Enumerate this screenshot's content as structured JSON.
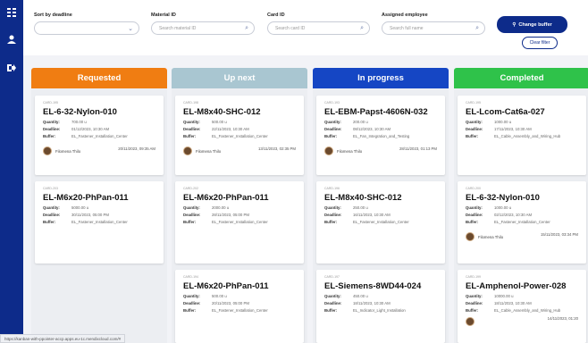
{
  "sidebar": {
    "icons": [
      "grid-icon",
      "user-icon",
      "logout-icon"
    ]
  },
  "filters": {
    "sort_label": "Sort by deadline",
    "sort_value": "",
    "material_label": "Material ID",
    "material_placeholder": "Search material ID",
    "card_label": "Card ID",
    "card_placeholder": "Search card ID",
    "employee_label": "Assigned employee",
    "employee_placeholder": "Search full name",
    "change_buffer_label": "Change buffer",
    "clear_filter_label": "Clear filter"
  },
  "colors": {
    "requested": "#f07d12",
    "up_next": "#a9c6d1",
    "in_progress": "#1546c4",
    "completed": "#2fc24a"
  },
  "labels": {
    "quantity": "Quantity:",
    "deadline": "Deadline:",
    "buffer": "Buffer:"
  },
  "columns": [
    {
      "title": "Requested",
      "cards": [
        {
          "id": "CARD-195",
          "title": "EL-6-32-Nylon-010",
          "quantity": "700.00 u",
          "deadline": "01/12/2023, 10:30 AM",
          "buffer": "EL_Fastener_Installation_Center",
          "assignee": "Filomena Thilo",
          "assigned_date": "20/11/2023, 09:35 AM"
        },
        {
          "id": "CARD-203",
          "title": "EL-M6x20-PhPan-011",
          "quantity": "5000.00 u",
          "deadline": "30/11/2023, 05:00 PM",
          "buffer": "EL_Fastener_Installation_Center"
        }
      ]
    },
    {
      "title": "Up next",
      "cards": [
        {
          "id": "CARD-198",
          "title": "EL-M8x40-SHC-012",
          "quantity": "500.00 u",
          "deadline": "22/11/2023, 10:30 AM",
          "buffer": "EL_Fastener_Installation_Center",
          "assignee": "Filomena Thilo",
          "assigned_date": "13/11/2023, 02:35 PM"
        },
        {
          "id": "CARD-202",
          "title": "EL-M6x20-PhPan-011",
          "quantity": "2000.00 u",
          "deadline": "28/11/2023, 05:00 PM",
          "buffer": "EL_Fastener_Installation_Center"
        },
        {
          "id": "CARD-194",
          "title": "EL-M6x20-PhPan-011",
          "quantity": "500.00 u",
          "deadline": "20/11/2023, 05:00 PM",
          "buffer": "EL_Fastener_Installation_Center"
        }
      ]
    },
    {
      "title": "In progress",
      "cards": [
        {
          "id": "CARD-193",
          "title": "EL-EBM-Papst-4606N-032",
          "quantity": "200.00 u",
          "deadline": "08/12/2023, 10:30 AM",
          "buffer": "EL_Fan_Integration_and_Testing",
          "assignee": "Filomena Thilo",
          "assigned_date": "28/11/2023, 01:13 PM"
        },
        {
          "id": "CARD-196",
          "title": "EL-M8x40-SHC-012",
          "quantity": "250.00 u",
          "deadline": "16/11/2023, 10:30 AM",
          "buffer": "EL_Fastener_Installation_Center"
        },
        {
          "id": "CARD-197",
          "title": "EL-Siemens-8WD44-024",
          "quantity": "450.00 u",
          "deadline": "18/11/2023, 10:30 AM",
          "buffer": "EL_Indicator_Light_Installation"
        }
      ]
    },
    {
      "title": "Completed",
      "cards": [
        {
          "id": "CARD-195",
          "title": "EL-Lcom-Cat6a-027",
          "quantity": "1000.00 u",
          "deadline": "17/11/2023, 10:30 AM",
          "buffer": "EL_Cable_Assembly_and_Wiring_Hub"
        },
        {
          "id": "CARD-200",
          "title": "EL-6-32-Nylon-010",
          "quantity": "1000.00 u",
          "deadline": "02/12/2023, 10:30 AM",
          "buffer": "EL_Fastener_Installation_Center",
          "assignee": "Filomena Thilo",
          "assigned_date": "15/11/2023, 03:34 PM"
        },
        {
          "id": "CARD-199",
          "title": "EL-Amphenol-Power-028",
          "quantity": "10000.00 u",
          "deadline": "18/11/2023, 10:30 AM",
          "buffer": "EL_Cable_Assembly_and_Wiring_Hub",
          "assigned_date": "14/11/2023, 01:20"
        }
      ]
    }
  ],
  "status_url": "https://kanban-with-ppointer-accp.apps.eu-1c.mendixcloud.com/#"
}
